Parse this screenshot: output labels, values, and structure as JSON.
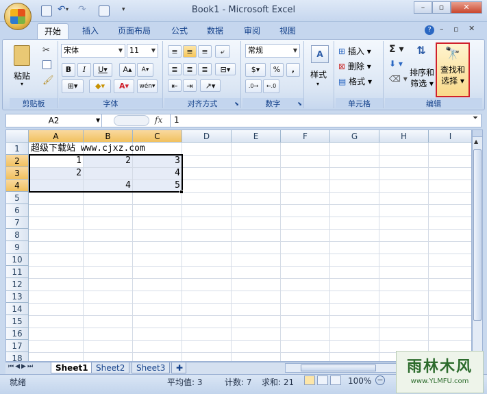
{
  "window": {
    "title": "Book1 - Microsoft Excel",
    "min_icon": "minimize-icon",
    "max_icon": "restore-icon",
    "close_icon": "close-icon"
  },
  "tabs": [
    "开始",
    "插入",
    "页面布局",
    "公式",
    "数据",
    "审阅",
    "视图"
  ],
  "ribbon": {
    "clipboard": {
      "label": "剪贴板",
      "paste": "粘贴"
    },
    "font": {
      "label": "字体",
      "name": "宋体",
      "size": "11"
    },
    "alignment": {
      "label": "对齐方式"
    },
    "number": {
      "label": "数字",
      "format": "常规",
      "style": "样式"
    },
    "cells": {
      "label": "单元格",
      "insert": "插入",
      "delete": "删除",
      "format": "格式"
    },
    "editing": {
      "label": "编辑",
      "sort": "排序和\n筛选",
      "sort_l1": "排序和",
      "sort_l2": "筛选",
      "find_l1": "查找和",
      "find_l2": "选择",
      "highlight_color": "#d0202b"
    }
  },
  "formula_bar": {
    "name_box": "A2",
    "fx": "fx",
    "value": "1"
  },
  "grid": {
    "columns": [
      "A",
      "B",
      "C",
      "D",
      "E",
      "F",
      "G",
      "H",
      "I"
    ],
    "rows": [
      "1",
      "2",
      "3",
      "4",
      "5",
      "6",
      "7",
      "8",
      "9",
      "10",
      "11",
      "12",
      "13",
      "14",
      "15",
      "16",
      "17",
      "18"
    ],
    "cells": {
      "A1": "超级下载站 www.cjxz.com",
      "A2": "1",
      "B2": "2",
      "C2": "3",
      "A3": "2",
      "C3": "4",
      "B4": "4",
      "C4": "5"
    }
  },
  "sheets": [
    "Sheet1",
    "Sheet2",
    "Sheet3"
  ],
  "status": {
    "ready": "就绪",
    "average": "平均值: 3",
    "count": "计数: 7",
    "sum": "求和: 21",
    "zoom": "100%"
  },
  "watermark": {
    "brand": "雨林木风",
    "url": "www.YLMFU.com"
  }
}
